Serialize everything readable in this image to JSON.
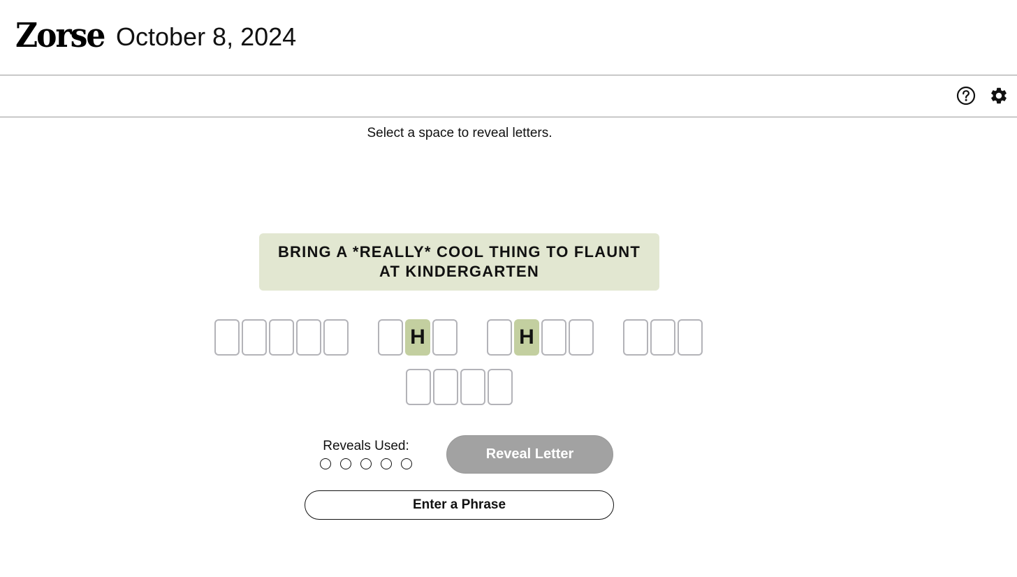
{
  "header": {
    "logo": "Zorse",
    "date": "October 8, 2024"
  },
  "toolbar": {
    "help_icon": "help-circle-icon",
    "settings_icon": "gear-icon"
  },
  "instruction": "Select a space to reveal letters.",
  "clue": "BRING A *REALLY* COOL THING TO FLAUNT AT KINDERGARTEN",
  "puzzle": {
    "row1": [
      [
        "",
        "",
        "",
        "",
        ""
      ],
      [
        "",
        "H",
        ""
      ],
      [
        "",
        "H",
        "",
        ""
      ],
      [
        "",
        "",
        ""
      ]
    ],
    "row2": [
      [
        "",
        "",
        "",
        ""
      ]
    ]
  },
  "colors": {
    "clue_background": "#e2e7d1",
    "revealed_tile": "#c3cfa0",
    "tile_border": "#b3b3b8",
    "disabled_button": "#a2a2a2"
  },
  "reveals": {
    "label": "Reveals Used:",
    "used": 0,
    "total": 5
  },
  "buttons": {
    "reveal_letter": "Reveal Letter",
    "enter_phrase": "Enter a Phrase"
  }
}
